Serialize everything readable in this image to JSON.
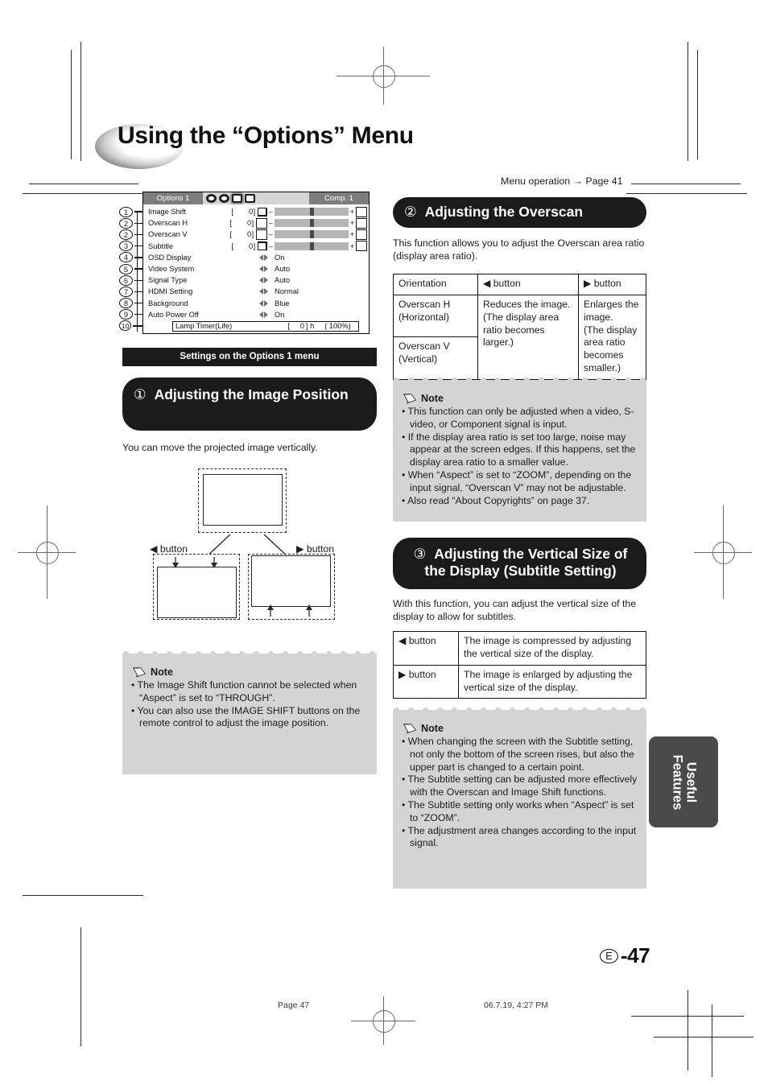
{
  "page_title": "Using the “Options” Menu",
  "menu_operation_ref": "Menu operation → Page 41",
  "osd": {
    "tab_label": "Options 1",
    "source_label": "Comp. 1",
    "icons": [
      "picture-icon",
      "audio-icon",
      "options1-icon",
      "options2-icon"
    ],
    "slider_rows": [
      {
        "label": "Image Shift",
        "value": "0",
        "left_icon": "image-shift-icon",
        "right_icon": "image-shift-max-icon"
      },
      {
        "label": "Overscan H",
        "value": "0",
        "left_icon": "overscan-h-icon",
        "right_icon": "overscan-h-max-icon"
      },
      {
        "label": "Overscan V",
        "value": "0",
        "left_icon": "overscan-v-icon",
        "right_icon": "overscan-v-max-icon"
      },
      {
        "label": "Subtitle",
        "value": "0",
        "left_icon": "subtitle-icon",
        "right_icon": "subtitle-max-icon"
      }
    ],
    "option_rows": [
      {
        "label": "OSD Display",
        "value": "On"
      },
      {
        "label": "Video System",
        "value": "Auto"
      },
      {
        "label": "Signal Type",
        "value": "Auto"
      },
      {
        "label": "HDMI Setting",
        "value": "Normal"
      },
      {
        "label": "Background",
        "value": "Blue"
      },
      {
        "label": "Auto Power Off",
        "value": "On"
      }
    ],
    "lamp_timer": {
      "label": "Lamp Timer(Life)",
      "bracket_left": "[",
      "value": "0",
      "unit": "] h",
      "percent": "( 100%)"
    },
    "callouts": [
      "1",
      "2",
      "2",
      "3",
      "4",
      "5",
      "6",
      "7",
      "8",
      "9",
      "10"
    ],
    "minus": "–",
    "plus": "+"
  },
  "left_column": {
    "settings_bar": "Settings on the Options 1 menu",
    "section1": {
      "number": "①",
      "title": "Adjusting the Image Position",
      "intro": "You can move the projected image vertically.",
      "diagram": {
        "left_button_label": "◀ button",
        "right_button_label": "▶ button"
      },
      "note": {
        "title": "Note",
        "items": [
          "The Image Shift function cannot be selected when “Aspect” is set to “THROUGH”.",
          "You can also use the IMAGE SHIFT buttons on the remote control to adjust the image position."
        ]
      }
    }
  },
  "right_column": {
    "section2": {
      "number": "②",
      "title": "Adjusting the Overscan",
      "intro": "This function allows you to adjust the Overscan area ratio (display area ratio).",
      "table": {
        "headers": [
          "Orientation",
          "◀ button",
          "▶ button"
        ],
        "rows": [
          [
            "Overscan H (Horizontal)",
            "Reduces the image. (The display area ratio becomes larger.)",
            "Enlarges the image. (The display area ratio becomes smaller.)"
          ],
          [
            "Overscan V (Vertical)",
            "",
            ""
          ]
        ]
      },
      "note": {
        "title": "Note",
        "items": [
          "This function can only be adjusted when a video, S-video, or Component signal is input.",
          "If the display area ratio is set too large, noise may appear at the screen edges. If this happens, set the display area ratio to a smaller value.",
          "When “Aspect” is set to “ZOOM”, depending on the input signal, “Overscan V” may not be adjustable.",
          "Also read “About Copyrights” on page 37."
        ]
      }
    },
    "section3": {
      "number": "③",
      "title": "Adjusting the Vertical Size of the Display (Subtitle Setting)",
      "intro": "With this function, you can adjust the vertical size of the display to allow for subtitles.",
      "table": {
        "rows": [
          [
            "◀ button",
            "The image is compressed by adjusting the vertical size of the display."
          ],
          [
            "▶ button",
            "The image is enlarged by adjusting the vertical size of the display."
          ]
        ]
      },
      "note": {
        "title": "Note",
        "items": [
          "When changing the screen with the Subtitle setting, not only the bottom of the screen rises, but also the upper part is changed to a certain point.",
          "The Subtitle setting can be adjusted more effectively with the Overscan and Image Shift functions.",
          "The Subtitle setting only works when “Aspect” is set to “ZOOM”.",
          "The adjustment area changes according to the input signal."
        ]
      }
    }
  },
  "side_tab": {
    "line1": "Useful",
    "line2": "Features"
  },
  "page_number": {
    "lang": "E",
    "value": "-47"
  },
  "footer": {
    "left": "Page 47",
    "right": "06.7.19, 4:27 PM"
  }
}
